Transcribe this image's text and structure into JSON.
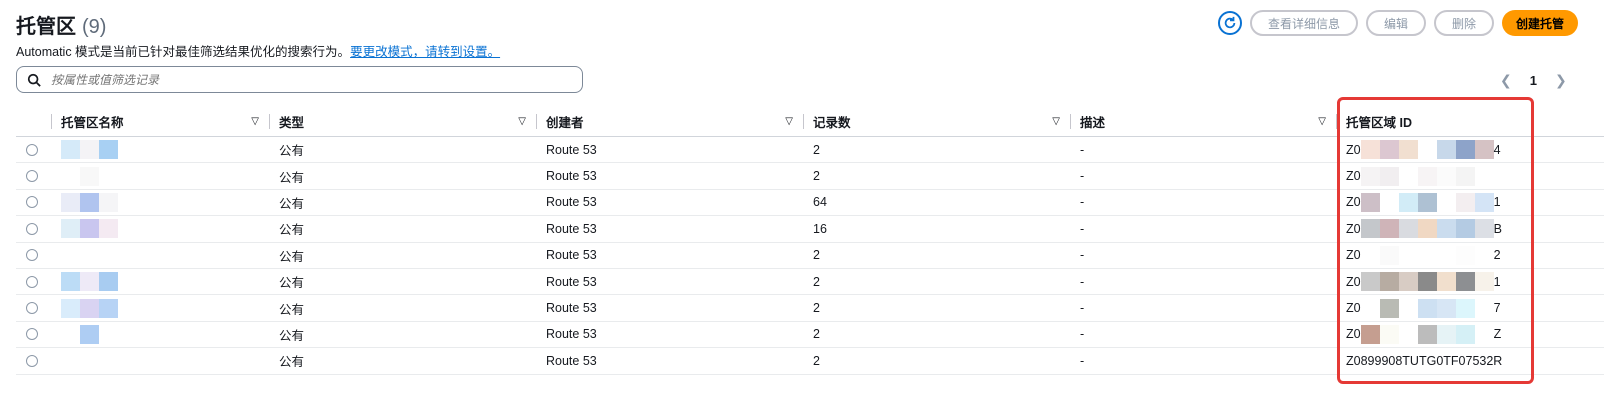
{
  "header": {
    "title": "托管区",
    "count": "(9)",
    "subtitle": "Automatic 模式是当前已针对最佳筛选结果优化的搜索行为。",
    "subtitle_link": "要更改模式，请转到设置。"
  },
  "actions": {
    "refresh_icon": "refresh-icon",
    "view_details": "查看详细信息",
    "edit": "编辑",
    "delete": "删除",
    "create": "创建托管"
  },
  "search": {
    "placeholder": "按属性或值筛选记录"
  },
  "pagination": {
    "page": "1"
  },
  "table": {
    "columns": [
      "托管区名称",
      "类型",
      "创建者",
      "记录数",
      "描述",
      "托管区域 ID"
    ],
    "rows": [
      {
        "type": "公有",
        "created_by": "Route 53",
        "records": "2",
        "description": "-",
        "zone_id_prefix": "Z0",
        "zone_id_suffix": "4"
      },
      {
        "type": "公有",
        "created_by": "Route 53",
        "records": "2",
        "description": "-",
        "zone_id_prefix": "Z0",
        "zone_id_suffix": ""
      },
      {
        "type": "公有",
        "created_by": "Route 53",
        "records": "64",
        "description": "-",
        "zone_id_prefix": "Z0",
        "zone_id_suffix": "1"
      },
      {
        "type": "公有",
        "created_by": "Route 53",
        "records": "16",
        "description": "-",
        "zone_id_prefix": "Z0",
        "zone_id_suffix": "B"
      },
      {
        "type": "公有",
        "created_by": "Route 53",
        "records": "2",
        "description": "-",
        "zone_id_prefix": "Z0",
        "zone_id_suffix": "2"
      },
      {
        "type": "公有",
        "created_by": "Route 53",
        "records": "2",
        "description": "-",
        "zone_id_prefix": "Z0",
        "zone_id_suffix": "1"
      },
      {
        "type": "公有",
        "created_by": "Route 53",
        "records": "2",
        "description": "-",
        "zone_id_prefix": "Z0",
        "zone_id_suffix": "7"
      },
      {
        "type": "公有",
        "created_by": "Route 53",
        "records": "2",
        "description": "-",
        "zone_id_prefix": "Z0",
        "zone_id_suffix": "Z"
      },
      {
        "type": "公有",
        "created_by": "Route 53",
        "records": "2",
        "description": "-",
        "zone_id_prefix": "Z0899908TUTG0TF07532R",
        "zone_id_suffix": ""
      }
    ]
  },
  "colors": {
    "accent": "#0972d3",
    "primary": "#ff9900",
    "highlight": "#e53935"
  }
}
